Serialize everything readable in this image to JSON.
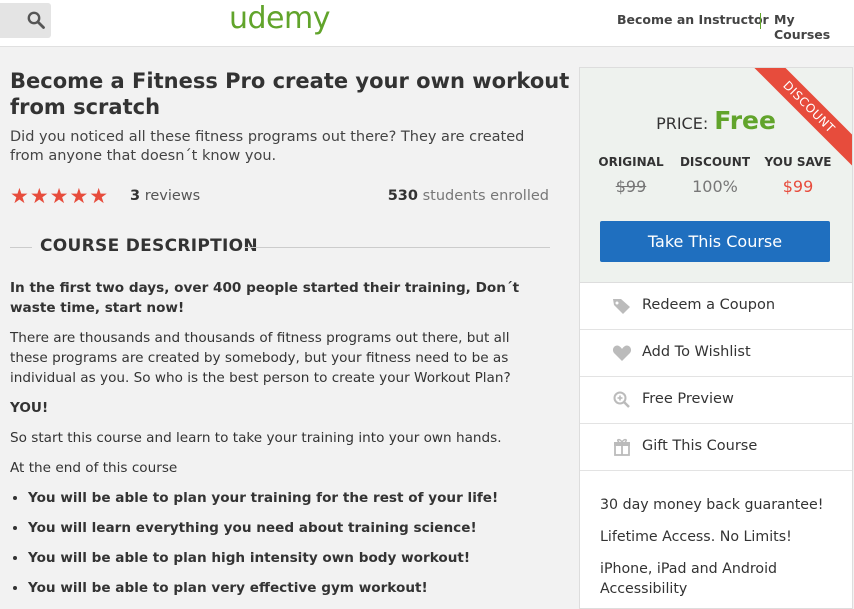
{
  "header": {
    "logo": "udemy",
    "become_instructor": "Become an Instructor",
    "my_courses": "My Courses"
  },
  "course": {
    "title": "Become a Fitness Pro create your own workout from scratch",
    "subtitle": "Did you noticed all these fitness programs out there? They are created from anyone that doesn´t know you.",
    "rating_stars": 5,
    "reviews_count": "3",
    "reviews_label": "reviews",
    "students_count": "530",
    "students_label": "students enrolled"
  },
  "description": {
    "heading": "COURSE DESCRIPTION",
    "intro_bold": "In the first two days, over 400 people started their training, Don´t waste time, start now!",
    "para1": "There are thousands and thousands of fitness programs out there, but all these programs are created by somebody, but your fitness need to be as individual as you. So who is the best person to create your Workout Plan?",
    "you": "YOU!",
    "para2": "So start this course and learn to take your training into your own hands.",
    "para3": "At the end of this course",
    "bullets": [
      "You will be able to plan your training for the rest of your life!",
      "You will learn everything you need about training science!",
      "You will be able to plan high intensity own body workout!",
      "You will be able to plan very effective gym workout!"
    ]
  },
  "pricing": {
    "ribbon": "DISCOUNT",
    "price_label": "PRICE:",
    "price_value": "Free",
    "original_label": "ORIGINAL",
    "original_value": "$99",
    "discount_label": "DISCOUNT",
    "discount_value": "100%",
    "save_label": "YOU SAVE",
    "save_value": "$99",
    "take_course": "Take This Course"
  },
  "actions": [
    {
      "label": "Redeem a Coupon",
      "icon": "tag-icon"
    },
    {
      "label": "Add To Wishlist",
      "icon": "heart-icon"
    },
    {
      "label": "Free Preview",
      "icon": "zoom-icon"
    },
    {
      "label": "Gift This Course",
      "icon": "gift-icon"
    }
  ],
  "info": {
    "guarantee": "30 day money back guarantee!",
    "lifetime": "Lifetime Access. No Limits!",
    "devices": "iPhone, iPad and Android Accessibility"
  },
  "colors": {
    "brand_green": "#61a42b",
    "accent_red": "#e74c3c",
    "button_blue": "#1f6fbf"
  }
}
